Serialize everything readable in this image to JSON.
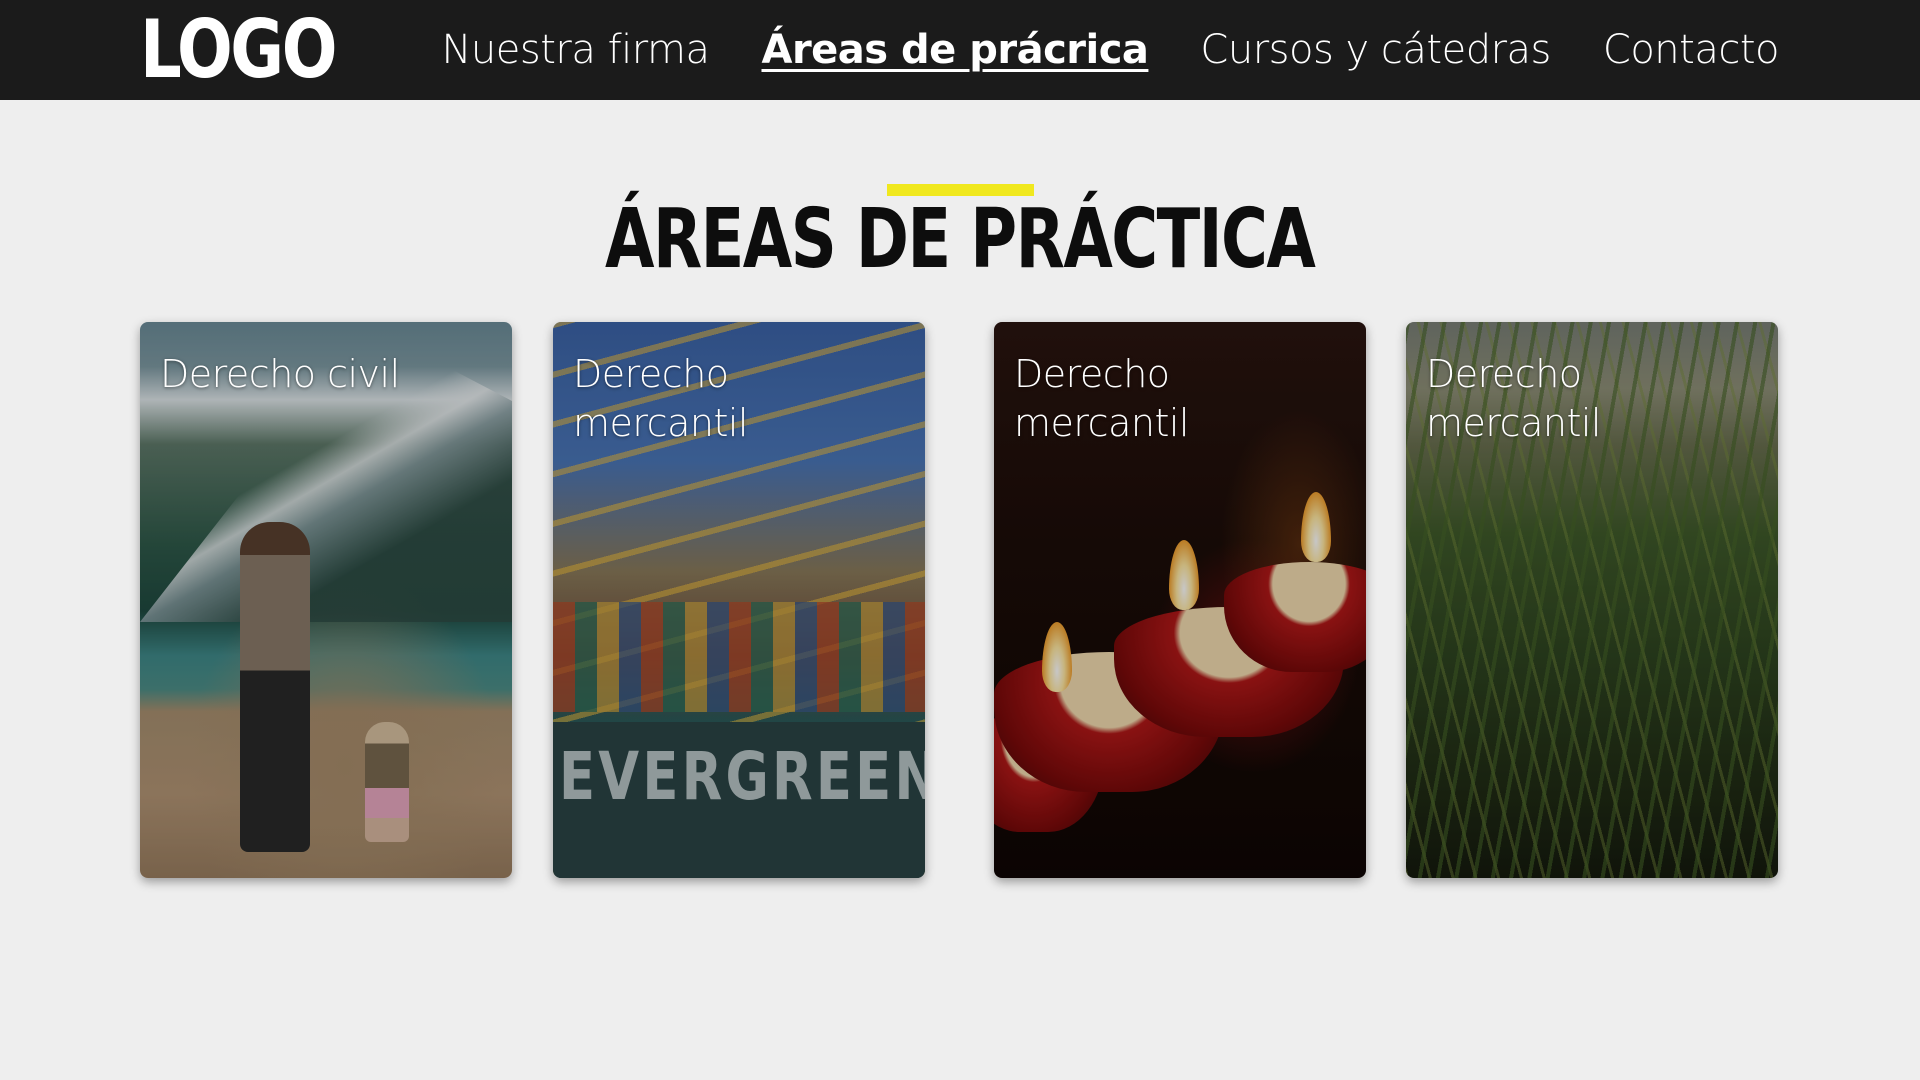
{
  "header": {
    "logo": "LOGO",
    "nav": [
      {
        "label": "Nuestra firma",
        "active": false
      },
      {
        "label": "Áreas de prácrica",
        "active": true
      },
      {
        "label": "Cursos y cátedras",
        "active": false
      },
      {
        "label": "Contacto",
        "active": false
      }
    ]
  },
  "section": {
    "title": "ÁREAS DE PRÁCTICA",
    "accent_color": "#f0e81e"
  },
  "cards": [
    {
      "label": "Derecho civil",
      "image": "mother-and-children-at-mountain-lake"
    },
    {
      "label": "Derecho mercantil",
      "image": "container-port-cranes-evergreen-ship",
      "image_text": "EVERGREEN"
    },
    {
      "label": "Derecho mercantil",
      "image": "red-candles"
    },
    {
      "label": "Derecho mercantil",
      "image": "corn-field"
    }
  ]
}
